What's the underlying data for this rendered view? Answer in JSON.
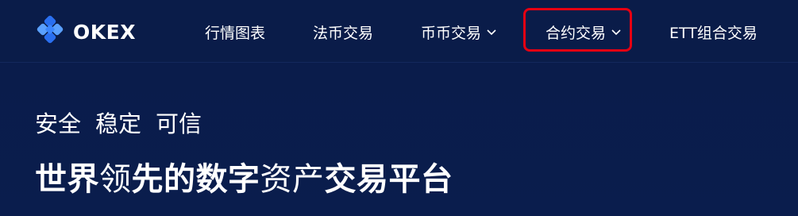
{
  "brand": {
    "name": "OKEX",
    "colors": {
      "background": "#0a1c4a",
      "logo_light": "#5aa0ff",
      "logo_dark": "#2a6ff0",
      "highlight": "#e60012"
    }
  },
  "nav": {
    "items": [
      {
        "label": "行情图表",
        "dropdown": false
      },
      {
        "label": "法币交易",
        "dropdown": false
      },
      {
        "label": "币币交易",
        "dropdown": true
      },
      {
        "label": "合约交易",
        "dropdown": true,
        "highlighted": true
      },
      {
        "label": "ETT组合交易",
        "dropdown": false
      }
    ]
  },
  "hero": {
    "tagline": [
      "安全",
      "稳定",
      "可信"
    ],
    "headline_parts": [
      {
        "text": "世界",
        "weight": "strong"
      },
      {
        "text": "领",
        "weight": "light"
      },
      {
        "text": "先的数字",
        "weight": "strong"
      },
      {
        "text": "资产",
        "weight": "light"
      },
      {
        "text": "交易平台",
        "weight": "strong"
      }
    ]
  },
  "icons": {
    "logo": "okex-logo-icon",
    "dropdown": "chevron-down-icon"
  }
}
